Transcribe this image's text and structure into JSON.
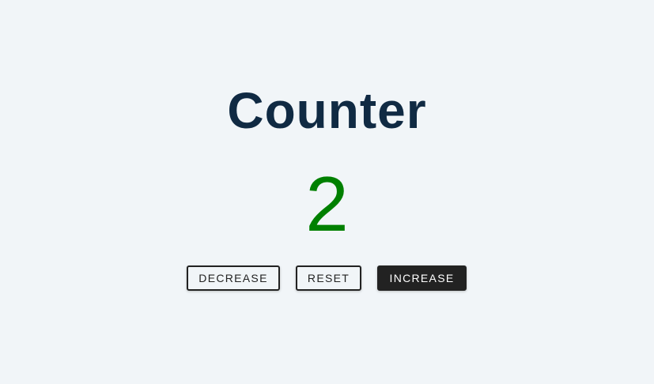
{
  "counter": {
    "title": "Counter",
    "value": "2",
    "value_color": "#008000"
  },
  "buttons": {
    "decrease": "DECREASE",
    "reset": "RESET",
    "increase": "INCREASE"
  },
  "colors": {
    "background": "#f1f5f8",
    "title": "#102a43",
    "button_dark": "#222222",
    "button_light_text": "#ffffff"
  }
}
